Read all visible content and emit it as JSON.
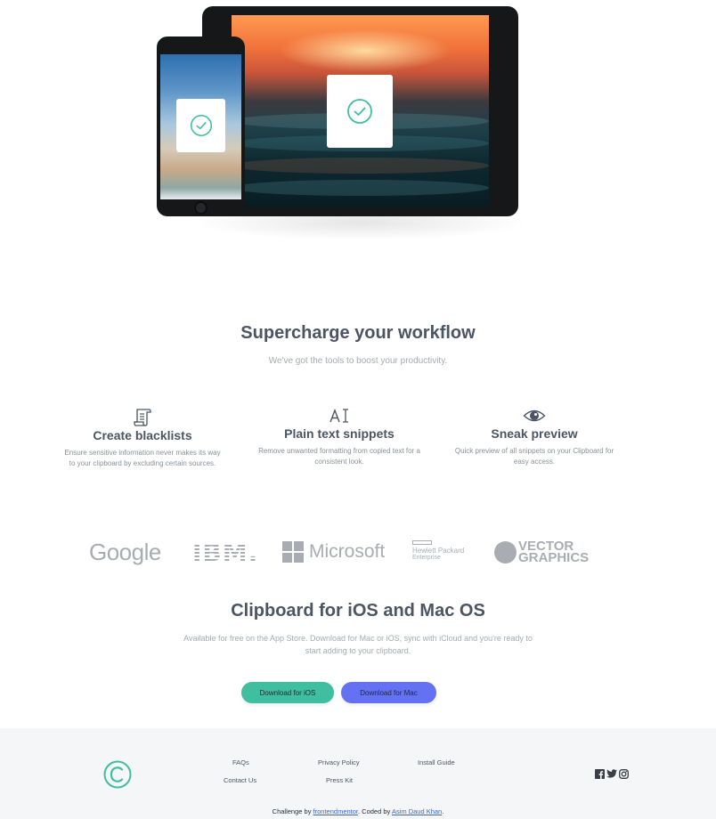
{
  "workflow": {
    "title": "Supercharge your workflow",
    "subtitle": "We've got the tools to boost your productivity.",
    "features": [
      {
        "icon": "blacklist-scroll-icon",
        "title": "Create blacklists",
        "description": "Ensure sensitive information never makes its way to your clipboard by excluding certain sources."
      },
      {
        "icon": "text-cursor-icon",
        "title": "Plain text snippets",
        "description": "Remove unwanted formatting from copied text for a consistent look."
      },
      {
        "icon": "eye-icon",
        "title": "Sneak preview",
        "description": "Quick preview of all snippets on your Clipboard for easy access."
      }
    ]
  },
  "logos": {
    "google": "Google",
    "ibm": "IBM.",
    "microsoft": "Microsoft",
    "hp_line1": "Hewlett Packard",
    "hp_line2": "Enterprise",
    "vector_line1": "VECTOR",
    "vector_line2": "GRAPHICS"
  },
  "download": {
    "title": "Clipboard for iOS and Mac OS",
    "description": "Available for free on the App Store. Download for Mac or iOS, sync with iCloud and you're ready to start adding to your clipboard.",
    "ios_button": "Download for iOS",
    "mac_button": "Download for Mac"
  },
  "footer": {
    "links": {
      "faqs": "FAQs",
      "contact": "Contact Us",
      "privacy": "Privacy Policy",
      "press": "Press Kit",
      "install": "Install Guide"
    },
    "attribution": {
      "prefix": "Challenge by ",
      "fm_link": "frontendmentor",
      "middle": ". Coded by ",
      "author_link": "Asim Daud Khan",
      "suffix": "."
    }
  },
  "colors": {
    "accent_green": "#3fbfa0",
    "accent_blue": "#6471f2",
    "heading": "#4c5563",
    "muted": "#a5aab2"
  },
  "icons": [
    "check-circle-icon",
    "blacklist-scroll-icon",
    "text-cursor-icon",
    "eye-icon",
    "clipboard-logo-icon",
    "facebook-icon",
    "twitter-icon",
    "instagram-icon"
  ]
}
